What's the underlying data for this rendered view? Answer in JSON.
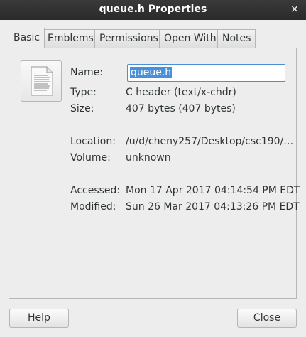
{
  "window": {
    "title": "queue.h Properties",
    "close_glyph": "×"
  },
  "tabs": [
    {
      "label": "Basic",
      "active": true
    },
    {
      "label": "Emblems"
    },
    {
      "label": "Permissions"
    },
    {
      "label": "Open With"
    },
    {
      "label": "Notes"
    }
  ],
  "basic": {
    "icon": "text-document-icon",
    "name_label": "Name:",
    "name_value": "queue.h",
    "type_label": "Type:",
    "type_value": "C header (text/x-chdr)",
    "size_label": "Size:",
    "size_value": "407 bytes (407 bytes)",
    "location_label": "Location:",
    "location_value": "/u/d/cheny257/Desktop/csc190/…",
    "volume_label": "Volume:",
    "volume_value": "unknown",
    "accessed_label": "Accessed:",
    "accessed_value": "Mon 17 Apr 2017 04:14:54 PM EDT",
    "modified_label": "Modified:",
    "modified_value": "Sun 26 Mar 2017 04:13:26 PM EDT"
  },
  "buttons": {
    "help": "Help",
    "close": "Close"
  },
  "colors": {
    "titlebar": "#2e2e2e",
    "selection": "#4a90d9",
    "background": "#ededed"
  }
}
